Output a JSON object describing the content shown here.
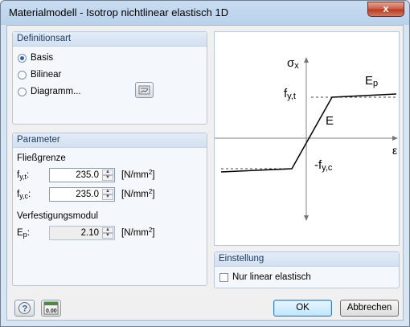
{
  "window": {
    "title": "Materialmodell - Isotrop nichtlinear elastisch 1D",
    "close_label": "x"
  },
  "definitionsart": {
    "header": "Definitionsart",
    "options": [
      {
        "label": "Basis",
        "checked": true
      },
      {
        "label": "Bilinear",
        "checked": false
      },
      {
        "label": "Diagramm...",
        "checked": false
      }
    ]
  },
  "parameter": {
    "header": "Parameter",
    "fliessgrenze_label": "Fließgrenze",
    "fyt": {
      "label_main": "f",
      "label_sub": "y,t",
      "label_colon": ":",
      "value": "235.0",
      "unit": "[N/mm",
      "unit_sup": "2",
      "unit_end": "]"
    },
    "fyc": {
      "label_main": "f",
      "label_sub": "y,c",
      "label_colon": ":",
      "value": "235.0",
      "unit": "[N/mm",
      "unit_sup": "2",
      "unit_end": "]"
    },
    "verfestigung_label": "Verfestigungsmodul",
    "ep": {
      "label_main": "E",
      "label_sub": "p",
      "label_colon": ":",
      "value": "2.10",
      "unit": "[N/mm",
      "unit_sup": "2",
      "unit_end": "]"
    }
  },
  "diagram": {
    "sigma_main": "σ",
    "sigma_sub": "x",
    "fyt_main": "f",
    "fyt_sub": "y,t",
    "fyc_main": "-f",
    "fyc_sub": "y,c",
    "ep_main": "E",
    "ep_sub": "p",
    "e_label": "E",
    "epsilon": "ε"
  },
  "einstellung": {
    "header": "Einstellung",
    "checkbox_label": "Nur linear elastisch",
    "checked": false
  },
  "footer": {
    "ok_label": "OK",
    "cancel_label": "Abbrechen",
    "units_icon_text": "0.00"
  }
}
